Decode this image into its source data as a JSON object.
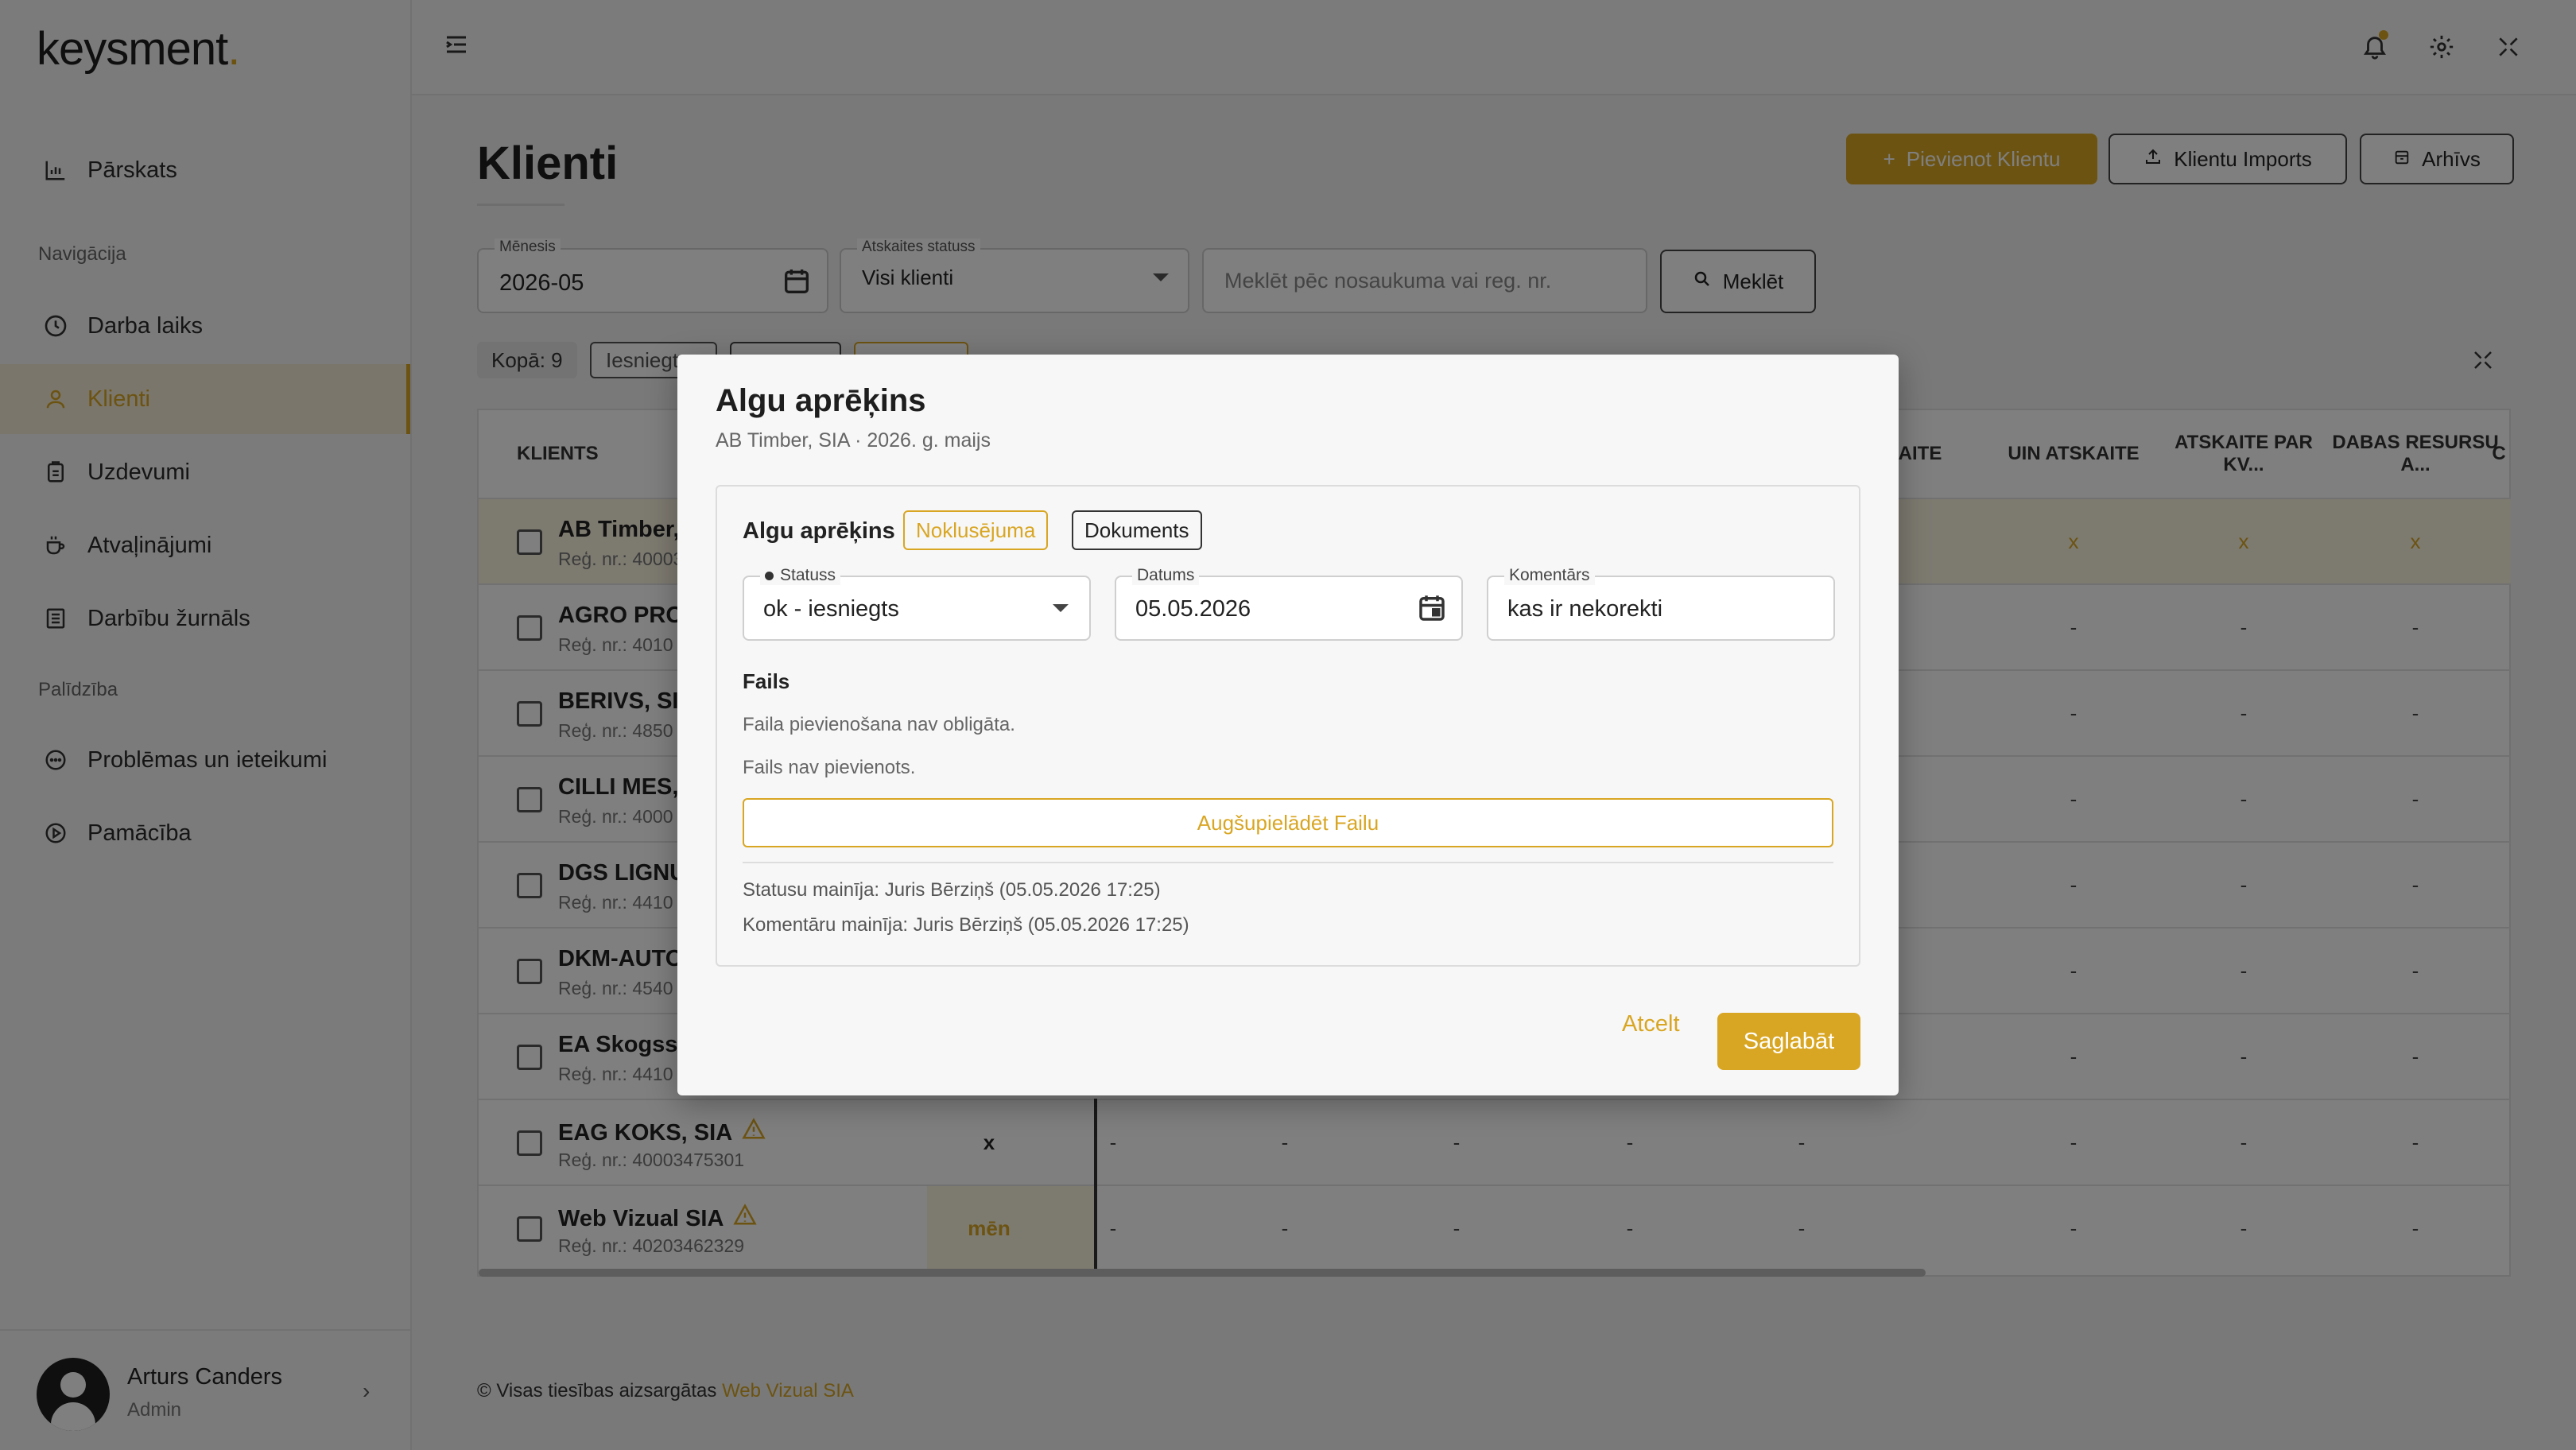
{
  "app": {
    "logo_text": "keysment",
    "logo_dot": ".",
    "accent_color": "#d9a623"
  },
  "sidebar": {
    "overview": "Pārskats",
    "nav_section": "Navigācija",
    "items": [
      {
        "label": "Darba laiks",
        "icon": "clock-icon"
      },
      {
        "label": "Klienti",
        "icon": "user-icon"
      },
      {
        "label": "Uzdevumi",
        "icon": "clipboard-icon"
      },
      {
        "label": "Atvaļinājumi",
        "icon": "coffee-icon"
      },
      {
        "label": "Darbību žurnāls",
        "icon": "list-icon"
      }
    ],
    "help_section": "Palīdzība",
    "help_items": [
      {
        "label": "Problēmas un ieteikumi",
        "icon": "chat-icon"
      },
      {
        "label": "Pamācība",
        "icon": "play-icon"
      }
    ],
    "user": {
      "name": "Arturs Canders",
      "role": "Admin"
    }
  },
  "header": {
    "page_title": "Klienti",
    "add_client": "Pievienot Klientu",
    "import": "Klientu Imports",
    "archive": "Arhīvs"
  },
  "filters": {
    "month_label": "Mēnesis",
    "month_value": "2026-05",
    "status_label": "Atskaites statuss",
    "status_value": "Visi klienti",
    "search_placeholder": "Meklēt pēc nosaukuma vai reg. nr.",
    "search_button": "Meklēt",
    "total": "Kopā: 9",
    "chip_submitted": "Iesniegts"
  },
  "table": {
    "headers": {
      "client": "KLIENTS",
      "h_aite": "AITE",
      "h_uin": "UIN ATSKAITE",
      "h_kv": "ATSKAITE PAR KV...",
      "h_dabas": "DABAS RESURSU A...",
      "h_c": "C"
    },
    "rows": [
      {
        "name": "AB Timber, SIA",
        "reg": "Reģ. nr.: 40003",
        "c1": "x",
        "c2": "x",
        "c3": "x",
        "col2": ""
      },
      {
        "name": "AGRO PROF",
        "reg": "Reģ. nr.: 4010",
        "c1": "-",
        "c2": "-",
        "c3": "-",
        "col2": ""
      },
      {
        "name": "BERIVS, SIA",
        "reg": "Reģ. nr.: 4850",
        "c1": "-",
        "c2": "-",
        "c3": "-",
        "col2": ""
      },
      {
        "name": "CILLI MES,",
        "reg": "Reģ. nr.: 4000",
        "c1": "-",
        "c2": "-",
        "c3": "-",
        "col2": ""
      },
      {
        "name": "DGS LIGNU",
        "reg": "Reģ. nr.: 4410",
        "c1": "-",
        "c2": "-",
        "c3": "-",
        "col2": ""
      },
      {
        "name": "DKM-AUTO",
        "reg": "Reģ. nr.: 4540",
        "c1": "-",
        "c2": "-",
        "c3": "-",
        "col2": ""
      },
      {
        "name": "EA Skogsse",
        "reg": "Reģ. nr.: 4410",
        "c1": "-",
        "c2": "-",
        "c3": "-",
        "col2": ""
      },
      {
        "name": "EAG KOKS, SIA",
        "reg": "Reģ. nr.: 40003475301",
        "c1": "-",
        "c2": "-",
        "c3": "-",
        "col2": "x"
      },
      {
        "name": "Web Vizual SIA",
        "reg": "Reģ. nr.: 40203462329",
        "c1": "-",
        "c2": "-",
        "c3": "-",
        "col2": "mēn"
      }
    ],
    "dash": "-"
  },
  "footer": {
    "text": "© Visas tiesības aizsargātas",
    "brand": "Web Vizual SIA"
  },
  "modal": {
    "title": "Algu aprēķins",
    "subtitle": "AB Timber, SIA · 2026. g. maijs",
    "card_title": "Algu aprēķins",
    "tag_default": "Noklusējuma",
    "tag_documents": "Dokuments",
    "status_label": "Statuss",
    "status_value": "ok - iesniegts",
    "date_label": "Datums",
    "date_value": "05.05.2026",
    "comment_label": "Komentārs",
    "comment_value": "kas ir nekorekti",
    "files_title": "Fails",
    "files_optional": "Faila pievienošana nav obligāta.",
    "files_none": "Fails nav pievienots.",
    "upload_button": "Augšupielādēt Failu",
    "status_changed": "Statusu mainīja: Juris Bērziņš (05.05.2026 17:25)",
    "comment_changed": "Komentāru mainīja: Juris Bērziņš (05.05.2026 17:25)",
    "cancel": "Atcelt",
    "save": "Saglabāt"
  }
}
